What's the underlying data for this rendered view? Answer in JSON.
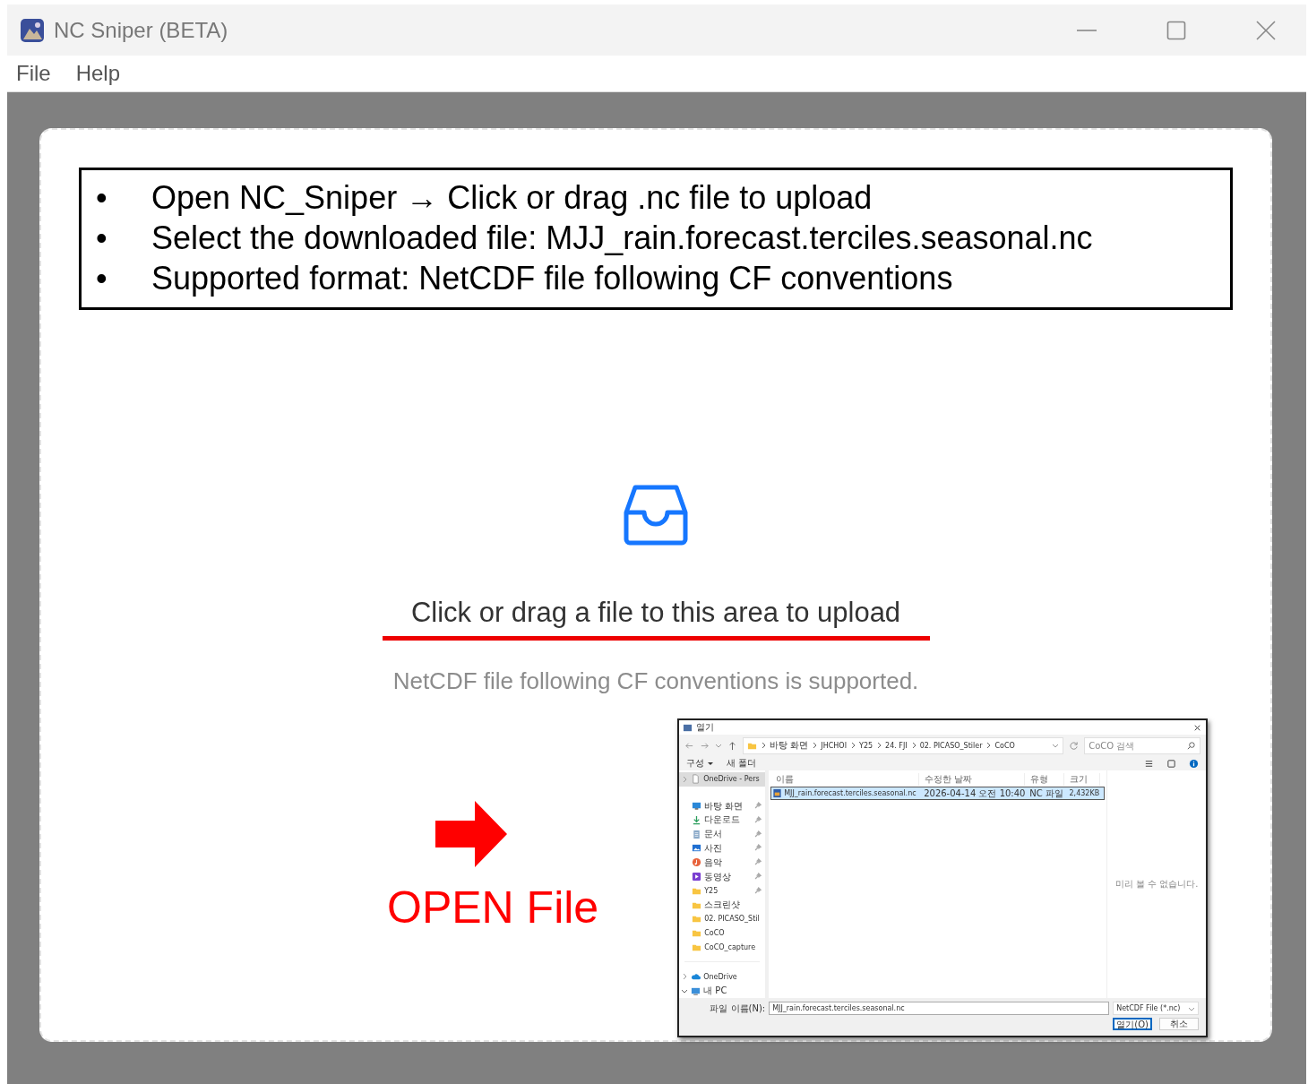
{
  "window": {
    "title": "NC Sniper (BETA)"
  },
  "menu": [
    {
      "label": "File"
    },
    {
      "label": "Help"
    }
  ],
  "instructions": [
    {
      "bullet": "•",
      "text": "Open NC_Sniper → Click or drag .nc file to upload"
    },
    {
      "bullet": "•",
      "text": "Select the downloaded file: MJJ_rain.forecast.terciles.seasonal.nc"
    },
    {
      "bullet": "•",
      "text": "Supported format: NetCDF file following CF conventions"
    }
  ],
  "upload": {
    "title": "Click or drag a file to this area to upload",
    "hint": "NetCDF file following CF conventions is supported."
  },
  "callout": {
    "label": "OPEN File"
  },
  "file_dialog": {
    "title": "열기",
    "path": [
      "바탕 화면",
      "JHCHOI",
      "Y25",
      "24. FJI",
      "02. PICASO_Stiler",
      "CoCO"
    ],
    "search": {
      "placeholder": "CoCO 검색"
    },
    "commands": [
      {
        "label": "구성",
        "caret": true
      },
      {
        "label": "새 폴더",
        "caret": false
      }
    ],
    "sidebar": {
      "top": [
        {
          "label": "OneDrive - Pers",
          "kind": "file",
          "expanded": false,
          "selected": true
        }
      ],
      "quick": [
        {
          "label": "바탕 화면",
          "kind": "desktop",
          "pinned": true,
          "selected": false
        },
        {
          "label": "다운로드",
          "kind": "download",
          "pinned": true,
          "selected": false
        },
        {
          "label": "문서",
          "kind": "documents",
          "pinned": true,
          "selected": false
        },
        {
          "label": "사진",
          "kind": "pictures",
          "pinned": true,
          "selected": false
        },
        {
          "label": "음악",
          "kind": "music",
          "pinned": true,
          "selected": false
        },
        {
          "label": "동영상",
          "kind": "videos",
          "pinned": true,
          "selected": false
        },
        {
          "label": "Y25",
          "kind": "folder",
          "pinned": true,
          "selected": false
        },
        {
          "label": "스크린샷",
          "kind": "folder",
          "pinned": false,
          "selected": false
        },
        {
          "label": "02. PICASO_Stil",
          "kind": "folder",
          "pinned": false,
          "selected": false
        },
        {
          "label": "CoCO",
          "kind": "folder",
          "pinned": false,
          "selected": false
        },
        {
          "label": "CoCO_capture",
          "kind": "folder",
          "pinned": false,
          "selected": false
        }
      ],
      "drives": [
        {
          "label": "OneDrive",
          "kind": "cloud",
          "expanded": false,
          "selected": false
        },
        {
          "label": "내 PC",
          "kind": "pc",
          "expanded": true,
          "selected": false
        }
      ]
    },
    "columns": [
      "이름",
      "수정한 날짜",
      "유형",
      "크기"
    ],
    "rows": [
      {
        "cells": [
          "MJJ_rain.forecast.terciles.seasonal.nc",
          "2026-04-14 오전 10:40",
          "NC 파일",
          "2,432KB"
        ],
        "selected": true
      }
    ],
    "preview": "미리 볼 수 없습니다.",
    "filename_label": "파일 이름(N):",
    "filename_value": "MJJ_rain.forecast.terciles.seasonal.nc",
    "filter": "NetCDF File (*.nc)",
    "buttons": [
      {
        "label": "열기(O)",
        "kind": "primary"
      },
      {
        "label": "취소",
        "kind": "secondary"
      }
    ]
  }
}
